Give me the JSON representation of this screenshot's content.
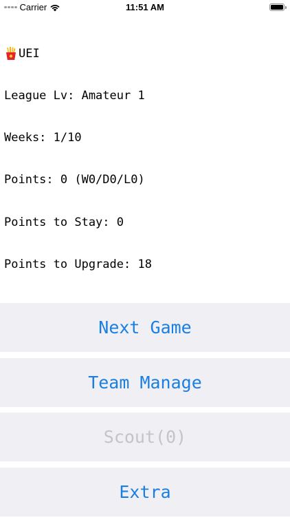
{
  "status_bar": {
    "carrier": "Carrier",
    "time": "11:51 AM",
    "icons": [
      "signal-dots-icon",
      "wifi-icon",
      "battery-icon"
    ]
  },
  "info": {
    "title_icon": "french-fries-icon",
    "title": "UEI",
    "league": "League Lv: Amateur 1",
    "weeks": "Weeks: 1/10",
    "points": "Points: 0 (W0/D0/L0)",
    "points_to_stay": "Points to Stay: 0",
    "points_to_upgrade": "Points to Upgrade: 18"
  },
  "buttons": {
    "next_game": "Next Game",
    "team_manage": "Team Manage",
    "scout": "Scout(0)",
    "extra": "Extra"
  },
  "colors": {
    "accent": "#1a7fe0",
    "button_bg": "#efeff4",
    "disabled_text": "#c4c4c8"
  }
}
